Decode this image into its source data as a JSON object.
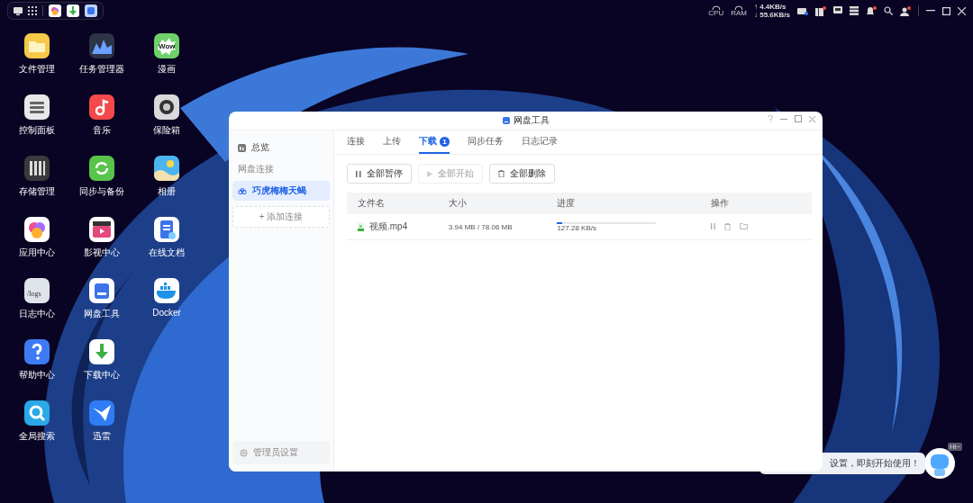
{
  "tray": {
    "gauges": [
      "CPU",
      "RAM"
    ],
    "upload_speed": "↑ 4.4KB/s",
    "download_speed": "↓ 55.6KB/s"
  },
  "desktop_icons": [
    {
      "label": "文件管理"
    },
    {
      "label": "控制面板"
    },
    {
      "label": "存储管理"
    },
    {
      "label": "应用中心"
    },
    {
      "label": "日志中心",
      "icon_text": "/logs"
    },
    {
      "label": "帮助中心"
    },
    {
      "label": "全局搜索"
    },
    {
      "label": "任务管理器"
    },
    {
      "label": "音乐"
    },
    {
      "label": "同步与备份"
    },
    {
      "label": "影视中心"
    },
    {
      "label": "网盘工具"
    },
    {
      "label": "下载中心"
    },
    {
      "label": "迅雷"
    },
    {
      "label": "漫画",
      "icon_text": "Wow"
    },
    {
      "label": "保险箱"
    },
    {
      "label": "相册"
    },
    {
      "label": "在线文档"
    },
    {
      "label": "Docker"
    }
  ],
  "window": {
    "title": "网盘工具",
    "sidebar": {
      "overview": "总览",
      "section": "网盘连接",
      "connections": [
        {
          "label": "巧虎梅梅天蝎",
          "selected": true
        }
      ],
      "add_button": "+ 添加连接",
      "admin_button": "管理员设置"
    },
    "tabs": [
      {
        "label": "连接",
        "selected": false
      },
      {
        "label": "上传",
        "selected": false
      },
      {
        "label": "下载",
        "selected": true,
        "badge": "1"
      },
      {
        "label": "同步任务",
        "selected": false
      },
      {
        "label": "日志记录",
        "selected": false
      }
    ],
    "toolbar": [
      {
        "kind": "pause",
        "label": "全部暂停",
        "disabled": false
      },
      {
        "kind": "play",
        "label": "全部开始",
        "disabled": true
      },
      {
        "kind": "delete",
        "label": "全部删除",
        "disabled": false
      }
    ],
    "table": {
      "columns": [
        "文件名",
        "大小",
        "进度",
        "操作"
      ],
      "rows": [
        {
          "name": "视频.mp4",
          "size": "3.94 MB / 78.06 MB",
          "level": 0.05,
          "speed": "127.28 KB/s"
        }
      ]
    }
  },
  "assistant": {
    "message": "设置，即刻开始使用！",
    "tag": "Hi~"
  }
}
